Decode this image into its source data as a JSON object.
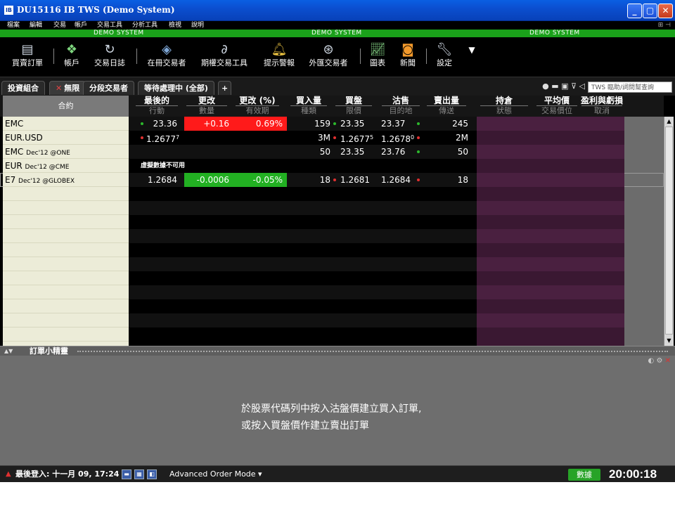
{
  "window": {
    "app_icon": "IB",
    "title": "DU15116 IB TWS (Demo System)",
    "buttons": [
      "_",
      "▢",
      "✕"
    ]
  },
  "menu": {
    "items": [
      "檔案",
      "編輯",
      "交易",
      "帳戶",
      "交易工具",
      "分析工具",
      "檢視",
      "說明"
    ]
  },
  "demo_banner": [
    "DEMO SYSTEM",
    "DEMO SYSTEM",
    "DEMO SYSTEM"
  ],
  "toolbar": {
    "items": [
      {
        "label": "買賣訂單",
        "icon": "order-ticket-icon"
      },
      {
        "label": "帳戶",
        "icon": "account-icon"
      },
      {
        "label": "交易日誌",
        "icon": "trade-log-icon"
      },
      {
        "label": "在冊交易者",
        "icon": "book-trader-icon"
      },
      {
        "label": "期權交易工具",
        "icon": "option-trader-icon"
      },
      {
        "label": "提示警報",
        "icon": "alert-icon"
      },
      {
        "label": "外匯交易者",
        "icon": "fx-trader-icon"
      },
      {
        "label": "圖表",
        "icon": "chart-icon"
      },
      {
        "label": "新聞",
        "icon": "news-icon"
      },
      {
        "label": "設定",
        "icon": "settings-icon"
      }
    ]
  },
  "tabs": [
    {
      "label": "投資組合"
    },
    {
      "label": "無限"
    },
    {
      "label": "分段交易者"
    },
    {
      "label": "等待處理中 (全部)"
    },
    {
      "label": "+"
    }
  ],
  "search": {
    "placeholder": "TWS 臨助/詞問幫查詢"
  },
  "columns": {
    "contract": "合約",
    "headers": [
      {
        "top": "最後的",
        "bottom": "行動"
      },
      {
        "top": "更改",
        "bottom": "數量"
      },
      {
        "top": "更改 (%)",
        "bottom": "有效期"
      },
      {
        "top": "買入量",
        "bottom": "種類"
      },
      {
        "top": "買盤",
        "bottom": "限價"
      },
      {
        "top": "沽售",
        "bottom": "目的地"
      },
      {
        "top": "賣出量",
        "bottom": "傳送"
      },
      {
        "top": "持倉",
        "bottom": "狀態"
      },
      {
        "top": "平均價",
        "bottom": "交易價位"
      },
      {
        "top": "盈利與虧損",
        "bottom": "取消"
      }
    ]
  },
  "rows": [
    {
      "symbol": "EMC",
      "suffix": "",
      "last": "23.36",
      "last_dot": "g",
      "change": "+0.16",
      "change_pct": "0.69%",
      "bid_size": "159",
      "bid": "23.35",
      "bid_dot": "g",
      "ask": "23.37",
      "ask_dot": "g",
      "ask_size": "245",
      "tone": "up"
    },
    {
      "symbol": "EUR.USD",
      "suffix": "",
      "last": "1.2677",
      "last_sup": "7",
      "last_dot": "r",
      "change": "",
      "change_pct": "",
      "bid_size": "3M",
      "bid": "1.2677",
      "bid_sup": "5",
      "bid_dot": "r",
      "ask": "1.2678",
      "ask_sup": "0",
      "ask_dot": "r",
      "ask_size": "2M",
      "tone": "none"
    },
    {
      "symbol": "EMC",
      "suffix": "Dec'12 @ONE",
      "last": "",
      "change": "",
      "change_pct": "",
      "bid_size": "50",
      "bid": "23.35",
      "ask": "23.76",
      "ask_dot": "g",
      "ask_size": "50",
      "tone": "none"
    },
    {
      "symbol": "EUR",
      "suffix": "Dec'12 @CME",
      "note": "虛擬數據不可用",
      "tone": "none"
    },
    {
      "symbol": "E7",
      "suffix": "Dec'12 @GLOBEX",
      "last": "1.2684",
      "change": "-0.0006",
      "change_pct": "-0.05%",
      "bid_size": "18",
      "bid": "1.2681",
      "bid_dot": "r",
      "ask": "1.2684",
      "ask_dot": "r",
      "ask_size": "18",
      "tone": "down",
      "selected": true
    }
  ],
  "colors": {
    "up_bg": "#ff1a1a",
    "down_bg": "#22b022",
    "contract_bg": "#ececd8",
    "purple": "#3a1832",
    "demo_green": "#1aa11a"
  },
  "wizard": {
    "title": "訂單小精靈",
    "message_line1": "於股票代碼列中按入沽盤價建立買入訂單,",
    "message_line2": "或按入買盤價作建立賣出訂單"
  },
  "status": {
    "last_login": "最後登入: 十一月 09, 17:24",
    "advanced_order_mode": "Advanced Order Mode",
    "data_button": "數據",
    "clock": "20:00:18"
  }
}
